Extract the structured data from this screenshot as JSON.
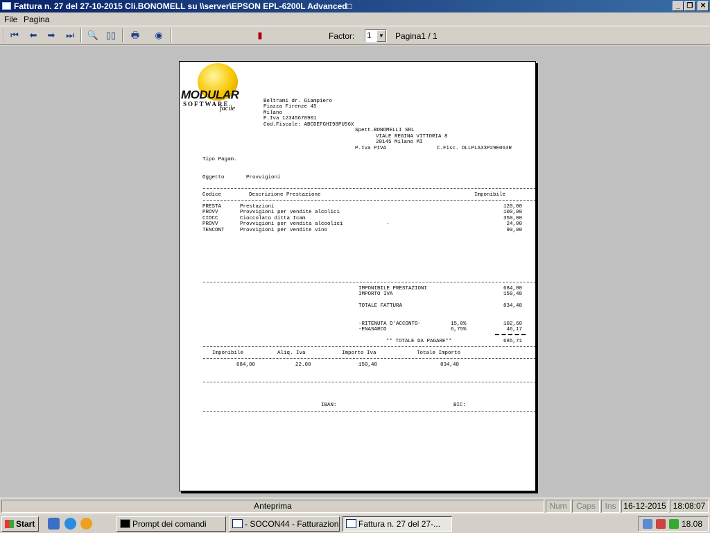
{
  "window": {
    "title": "Fattura n.  27 del 27-10-2015 Cli.BONOMELL su \\\\server\\EPSON EPL-6200L Advanced□",
    "minimize": "_",
    "restore": "❐",
    "close": "✕"
  },
  "menu": {
    "file": "File",
    "pagina": "Pagina"
  },
  "toolbar": {
    "factor_label": "Factor:",
    "factor_value": "1",
    "page_indicator": "Pagina1 / 1",
    "icons": [
      "first-page-icon",
      "previous-page-icon",
      "next-page-icon",
      "last-page-icon",
      "zoom-icon",
      "two-pages-icon",
      "print-icon",
      "export-icon",
      "exit-door-icon"
    ]
  },
  "document": {
    "logo": {
      "line1": "MODULAR",
      "line2": "SOFTWARE",
      "line3": "facile"
    },
    "sender": [
      "Beltrami dr. Giampiero",
      "Piazza Firenze 45",
      "Milano",
      "P.Iva 12345678901",
      "Cod.Fiscale: ABCDEFGHI98PU56X"
    ],
    "recipient": {
      "line1": "Spett.BONOMELLI SRL",
      "line2": "VIALE REGINA VITTORIA 8",
      "line3": "20145 Milano MI",
      "piva": "P.Iva PIVA",
      "cfisc": "C.Fisc. DLLPLA33P29E063R"
    },
    "tipo_pagam": "Tipo Pagam.",
    "oggetto_label": "Oggetto",
    "oggetto_value": "Provvigioni",
    "headers": {
      "codice": "Codice",
      "descrizione": "Descrizione Prestazione",
      "imponibile": "Imponibile"
    },
    "rows": [
      {
        "codice": "PRESTA",
        "descrizione": "Prestazioni",
        "extra": "",
        "importo": "120,00"
      },
      {
        "codice": "PROVV",
        "descrizione": "Provvigioni per vendite alcolici",
        "extra": "",
        "importo": "100,00"
      },
      {
        "codice": "CIOCC",
        "descrizione": "Cioccolato ditta Icam",
        "extra": "",
        "importo": "350,00"
      },
      {
        "codice": "PROVV",
        "descrizione": "Provvigioni per vendita alcoolici",
        "extra": "-",
        "importo": "24,00"
      },
      {
        "codice": "TENCONT",
        "descrizione": "Provvigioni per vendite vino",
        "extra": "",
        "importo": "90,00"
      }
    ],
    "totals": {
      "imponibile_label": "IMPONIBILE PRESTAZIONI",
      "imponibile_value": "684,00",
      "iva_label": "IMPORTO IVA",
      "iva_value": "150,48",
      "totale_label": "TOTALE FATTURA",
      "totale_value": "834,48",
      "ritenuta_label": "-RITENUTA D'ACCONTO-",
      "ritenuta_pct": "15,0%",
      "ritenuta_value": "102,60",
      "enasarco_label": "-ENASARCO",
      "enasarco_pct": "6,75%",
      "enasarco_value": "46,17",
      "pagare_label": "** TOTALE DA PAGARE**",
      "pagare_value": "685,71"
    },
    "iva_table": {
      "headers": {
        "imponibile": "Imponibile",
        "aliq": "Aliq. Iva",
        "importo": "Importo Iva",
        "totale": "Totale Importo"
      },
      "values": {
        "imponibile": "684,00",
        "aliq": "22.00",
        "importo": "150,48",
        "totale": "834,48"
      }
    },
    "iban_label": "IBAN:",
    "bic_label": "BIC:"
  },
  "statusbar": {
    "mode": "Anteprima",
    "num": "Num",
    "caps": "Caps",
    "ins": "Ins",
    "date": "16-12-2015",
    "time": "18:08:07"
  },
  "taskbar": {
    "start": "Start",
    "tasks": [
      "Prompt dei comandi",
      "- SOCON44 - Fatturazion...",
      "Fattura n.  27 del 27-..."
    ],
    "clock": "18.08"
  }
}
